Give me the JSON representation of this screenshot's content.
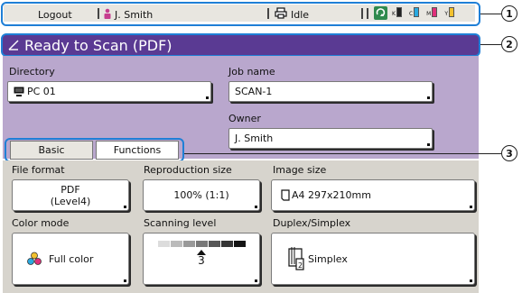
{
  "status_bar": {
    "logout_label": "Logout",
    "user_name": "J. Smith",
    "printer_status": "Idle",
    "ink": [
      {
        "label": "K",
        "color": "#222222"
      },
      {
        "label": "C",
        "color": "#29a9e0"
      },
      {
        "label": "M",
        "color": "#e0307a"
      },
      {
        "label": "Y",
        "color": "#f2c12e"
      }
    ]
  },
  "title": "Ready to Scan (PDF)",
  "main": {
    "directory_label": "Directory",
    "directory_value": "PC 01",
    "job_name_label": "Job name",
    "job_name_value": "SCAN-1",
    "owner_label": "Owner",
    "owner_value": "J. Smith"
  },
  "tabs": [
    {
      "label": "Basic",
      "active": false
    },
    {
      "label": "Functions",
      "active": true
    }
  ],
  "settings": {
    "file_format_label": "File format",
    "file_format_value_line1": "PDF",
    "file_format_value_line2": "(Level4)",
    "reproduction_size_label": "Reproduction size",
    "reproduction_size_value": "100% (1:1)",
    "image_size_label": "Image size",
    "image_size_value": "A4 297x210mm",
    "color_mode_label": "Color mode",
    "color_mode_value": "Full color",
    "scanning_level_label": "Scanning level",
    "scanning_level_value": "3",
    "scanning_level_max": 7,
    "duplex_label": "Duplex/Simplex",
    "duplex_value": "Simplex"
  },
  "callouts": [
    "1",
    "2",
    "3"
  ],
  "colors": {
    "title_bar": "#5a3a93",
    "main_panel": "#b9a7cd",
    "lower_panel": "#d7d4cd",
    "callout_ring": "#1f7fd6"
  }
}
